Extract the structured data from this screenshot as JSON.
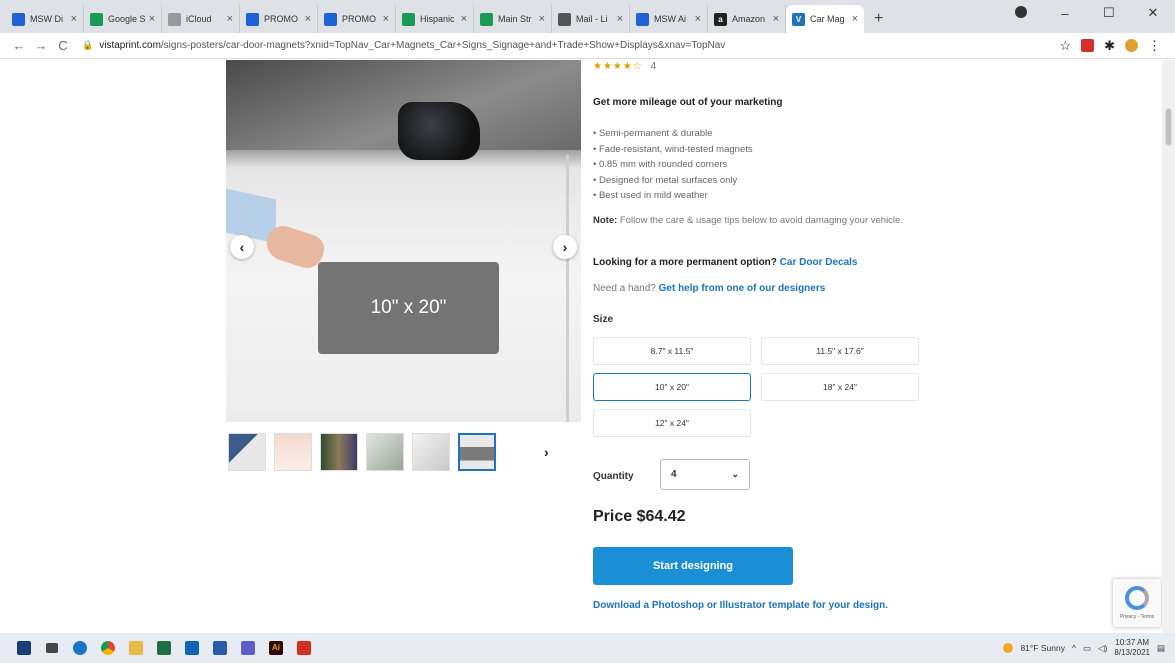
{
  "browser": {
    "tabs": [
      {
        "title": "MSW Di",
        "color": "#1e63d6",
        "glyph": ""
      },
      {
        "title": "Google S",
        "color": "#1a9b55",
        "glyph": ""
      },
      {
        "title": "iCloud",
        "color": "#999999",
        "glyph": ""
      },
      {
        "title": "PROMO",
        "color": "#1e63d6",
        "glyph": ""
      },
      {
        "title": "PROMO",
        "color": "#1e63d6",
        "glyph": ""
      },
      {
        "title": "Hispanic",
        "color": "#1a9b55",
        "glyph": ""
      },
      {
        "title": "Main Str",
        "color": "#1a9b55",
        "glyph": ""
      },
      {
        "title": "Mail - Li",
        "color": "#555555",
        "glyph": ""
      },
      {
        "title": "MSW Ai",
        "color": "#1e63d6",
        "glyph": ""
      },
      {
        "title": "Amazon",
        "color": "#222222",
        "glyph": "a"
      },
      {
        "title": "Car Mag",
        "color": "#1e73be",
        "glyph": "V"
      }
    ],
    "new_tab": "+",
    "window_controls": {
      "minimize": "–",
      "maximize": "☐",
      "close": "✕"
    },
    "nav": {
      "back": "←",
      "forward": "→",
      "reload": "C"
    },
    "url_host": "vistaprint.com",
    "url_path": "/signs-posters/car-door-magnets?xnid=TopNav_Car+Magnets_Car+Signs_Signage+and+Trade+Show+Displays&xnav=TopNav",
    "star": "☆"
  },
  "product": {
    "rating_stars": "★★★★☆",
    "rating_count": "4",
    "tagline": "Get more mileage out of your marketing",
    "bullets": [
      "• Semi-permanent & durable",
      "• Fade-resistant, wind-tested magnets",
      "• 0.85 mm with rounded corners",
      "• Designed for metal surfaces only",
      "• Best used in mild weather"
    ],
    "note_label": "Note:",
    "note_text": " Follow the care & usage tips below to avoid damaging your vehicle.",
    "permanent_text": "Looking for a more permanent option? ",
    "permanent_link": "Car Door Decals",
    "help_text": "Need a hand? ",
    "help_link": "Get help from one of our designers",
    "size_label": "Size",
    "sizes": [
      "8.7\" x 11.5\"",
      "11.5\" x 17.6\"",
      "10\" x 20\"",
      "18\" x 24\"",
      "12\" x 24\""
    ],
    "selected_size": "10\" x 20\"",
    "quantity_label": "Quantity",
    "quantity_value": "4",
    "price": "Price $64.42",
    "cta": "Start designing",
    "download_link": "Download a Photoshop or Illustrator template for your design."
  },
  "gallery": {
    "magnet_label": "10\" x 20\"",
    "prev": "‹",
    "next": "›",
    "thumbs_next": "›"
  },
  "recaptcha": {
    "text": "Privacy - Terms"
  },
  "taskbar": {
    "weather": "81°F  Sunny",
    "time": "10:37 AM",
    "date": "8/13/2021"
  }
}
